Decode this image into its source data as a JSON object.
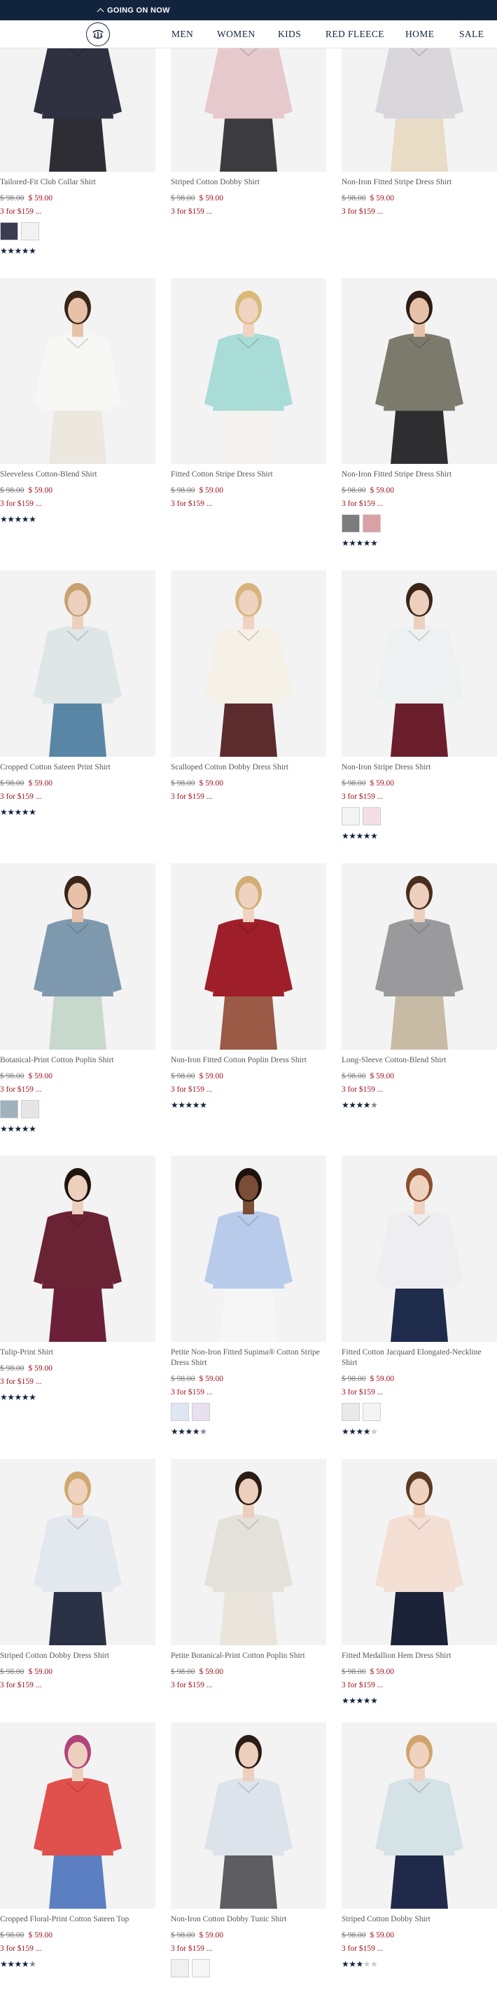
{
  "promo": {
    "label": "GOING ON NOW",
    "chevron_icon": "chevron-up-icon"
  },
  "header": {
    "logo_icon": "golden-fleece-logo-icon",
    "nav": [
      "MEN",
      "WOMEN",
      "KIDS",
      "RED FLEECE",
      "HOME",
      "SALE"
    ]
  },
  "colors": {
    "navy": "#12233d",
    "sale_red": "#a0121e"
  },
  "products": [
    {
      "name": "Tailored-Fit Club Collar Shirt",
      "was": "$ 98.00",
      "now": "$ 59.00",
      "deal": "3 for $159 ...",
      "swatches": [
        "#3b3b52",
        "#f2f2f2"
      ],
      "rating": 5,
      "bg": "#f2f2f2",
      "shirt": "#2f3040",
      "skin": "#e9c9b2",
      "hair": "#2a1b14",
      "pants": "#2d2d33"
    },
    {
      "name": "Striped Cotton Dobby Shirt",
      "was": "$ 98.00",
      "now": "$ 59.00",
      "deal": "3 for $159 ...",
      "swatches": [],
      "rating": 0,
      "bg": "#f3f3f3",
      "shirt": "#e6c9cc",
      "skin": "#ecd0bd",
      "hair": "#a37b4d",
      "pants": "#3c3c40"
    },
    {
      "name": "Non-Iron Fitted Stripe Dress Shirt",
      "was": "$ 98.00",
      "now": "$ 59.00",
      "deal": "3 for $159 ...",
      "swatches": [],
      "rating": 0,
      "bg": "#f3f3f3",
      "shirt": "#d9d6dc",
      "skin": "#ecd0bd",
      "hair": "#6b4a2e",
      "pants": "#e8dcc6"
    },
    {
      "name": "Sleeveless Cotton-Blend Shirt",
      "was": "$ 98.00",
      "now": "$ 59.00",
      "deal": "3 for $159 ...",
      "swatches": [],
      "rating": 5,
      "bg": "#f3f3f3",
      "shirt": "#f7f7f5",
      "skin": "#e7c2a8",
      "hair": "#3a2519",
      "pants": "#ece7df"
    },
    {
      "name": "Fitted Cotton Stripe Dress Shirt",
      "was": "$ 98.00",
      "now": "$ 59.00",
      "deal": "3 for $159 ...",
      "swatches": [],
      "rating": 0,
      "bg": "#f3f3f3",
      "shirt": "#a9dcd6",
      "skin": "#f0d4c1",
      "hair": "#d9b979",
      "pants": "#f4f2ee"
    },
    {
      "name": "Non-Iron Fitted Stripe Dress Shirt",
      "was": "$ 98.00",
      "now": "$ 59.00",
      "deal": "3 for $159 ...",
      "swatches": [
        "#7c7c7c",
        "#d9a0a6"
      ],
      "rating": 5,
      "bg": "#f3f3f3",
      "shirt": "#7b7a6c",
      "skin": "#e7c2a8",
      "hair": "#2b1d15",
      "pants": "#2e2e30"
    },
    {
      "name": "Cropped Cotton Sateen Print Shirt",
      "was": "$ 98.00",
      "now": "$ 59.00",
      "deal": "3 for $159 ...",
      "swatches": [],
      "rating": 5,
      "bg": "#f3f3f3",
      "shirt": "#dfe6e8",
      "skin": "#ecd0bd",
      "hair": "#c7a172",
      "pants": "#5a86a6"
    },
    {
      "name": "Scalloped Cotton Dobby Dress Shirt",
      "was": "$ 98.00",
      "now": "$ 59.00",
      "deal": "3 for $159 ...",
      "swatches": [],
      "rating": 0,
      "bg": "#f3f3f3",
      "shirt": "#f6f1e6",
      "skin": "#efd2bf",
      "hair": "#d8b47c",
      "pants": "#5c2b2e"
    },
    {
      "name": "Non-Iron Stripe Dress Shirt",
      "was": "$ 98.00",
      "now": "$ 59.00",
      "deal": "3 for $159 ...",
      "swatches": [
        "#f4f4f4",
        "#f3dfe4"
      ],
      "rating": 5,
      "bg": "#f3f3f3",
      "shirt": "#eef1f1",
      "skin": "#ecd0bd",
      "hair": "#3a2519",
      "pants": "#6b1f2c"
    },
    {
      "name": "Botanical-Print Cotton Poplin Shirt",
      "was": "$ 98.00",
      "now": "$ 59.00",
      "deal": "3 for $159 ...",
      "swatches": [
        "#9fb1bd",
        "#e6e6e6"
      ],
      "rating": 5,
      "bg": "#f3f3f3",
      "shirt": "#7e98ae",
      "skin": "#e7c2a8",
      "hair": "#3a2519",
      "pants": "#c7d8cd"
    },
    {
      "name": "Non-Iron Fitted Cotton Poplin Dress Shirt",
      "was": "$ 98.00",
      "now": "$ 59.00",
      "deal": "3 for $159 ...",
      "swatches": [],
      "rating": 5,
      "bg": "#f3f3f3",
      "shirt": "#9e1f2a",
      "skin": "#efd2bf",
      "hair": "#d2ae76",
      "pants": "#9a5a45"
    },
    {
      "name": "Long-Sleeve Cotton-Blend Shirt",
      "was": "$ 98.00",
      "now": "$ 59.00",
      "deal": "3 for $159 ...",
      "swatches": [],
      "rating": 4.5,
      "bg": "#f3f3f3",
      "shirt": "#9a9a9c",
      "skin": "#ecd0bd",
      "hair": "#4a2d1e",
      "pants": "#c8bba6"
    },
    {
      "name": "Tulip-Print Shirt",
      "was": "$ 98.00",
      "now": "$ 59.00",
      "deal": "3 for $159 ...",
      "swatches": [],
      "rating": 5,
      "bg": "#f3f3f3",
      "shirt": "#6a2334",
      "skin": "#ecd0bd",
      "hair": "#1f140e",
      "pants": "#6b2037"
    },
    {
      "name": "Petite Non-Iron Fitted Supima® Cotton Stripe Dress Shirt",
      "was": "$ 98.00",
      "now": "$ 59.00",
      "deal": "3 for $159 ...",
      "swatches": [
        "#dfe6f3",
        "#e8dff0"
      ],
      "rating": 4.5,
      "bg": "#f3f3f3",
      "shirt": "#b9cbea",
      "skin": "#7a4e36",
      "hair": "#1d120c",
      "pants": "#f6f6f6"
    },
    {
      "name": "Fitted Cotton Jacquard Elongated-Neckline Shirt",
      "was": "$ 98.00",
      "now": "$ 59.00",
      "deal": "3 for $159 ...",
      "swatches": [
        "#e9e9e9",
        "#f4f4f4"
      ],
      "rating": 4,
      "bg": "#f3f3f3",
      "shirt": "#eeeef0",
      "skin": "#efd2bf",
      "hair": "#8a4e2f",
      "pants": "#1f2b4b"
    },
    {
      "name": "Striped Cotton Dobby Dress Shirt",
      "was": "$ 98.00",
      "now": "$ 59.00",
      "deal": "3 for $159 ...",
      "swatches": [],
      "rating": 0,
      "bg": "#f3f3f3",
      "shirt": "#e3e8ee",
      "skin": "#efd2bf",
      "hair": "#cfa86e",
      "pants": "#2b3246"
    },
    {
      "name": "Petite Botanical-Print Cotton Poplin Shirt",
      "was": "$ 98.00",
      "now": "$ 59.00",
      "deal": "3 for $159 ...",
      "swatches": [],
      "rating": 0,
      "bg": "#f3f3f3",
      "shirt": "#e4e1da",
      "skin": "#ecd0bd",
      "hair": "#2b1d15",
      "pants": "#e9e5dc"
    },
    {
      "name": "Fitted Medallion Hem Dress Shirt",
      "was": "$ 98.00",
      "now": "$ 59.00",
      "deal": "3 for $159 ...",
      "swatches": [],
      "rating": 5,
      "bg": "#f3f3f3",
      "shirt": "#f4dfd5",
      "skin": "#efd2bf",
      "hair": "#5b3a24",
      "pants": "#1c2238"
    },
    {
      "name": "Cropped Floral-Print Cotton Sateen Top",
      "was": "$ 98.00",
      "now": "$ 59.00",
      "deal": "3 for $159 ...",
      "swatches": [],
      "rating": 4.5,
      "bg": "#f3f3f3",
      "shirt": "#e0504c",
      "skin": "#ecd0bd",
      "hair": "#b2437a",
      "pants": "#5b7fc0"
    },
    {
      "name": "Non-Iron Cotton Dobby Tunic Shirt",
      "was": "$ 98.00",
      "now": "$ 59.00",
      "deal": "3 for $159 ...",
      "swatches": [
        "#f0f0f0",
        "#f6f6f6"
      ],
      "rating": 0,
      "bg": "#f3f3f3",
      "shirt": "#dde3ea",
      "skin": "#ecd0bd",
      "hair": "#2b1d15",
      "pants": "#5d5d62"
    },
    {
      "name": "Striped Cotton Dobby Shirt",
      "was": "$ 98.00",
      "now": "$ 59.00",
      "deal": "3 for $159 ...",
      "swatches": [],
      "rating": 3,
      "bg": "#f3f3f3",
      "shirt": "#d5e2e6",
      "skin": "#efd2bf",
      "hair": "#d0a46b",
      "pants": "#20294a"
    }
  ]
}
